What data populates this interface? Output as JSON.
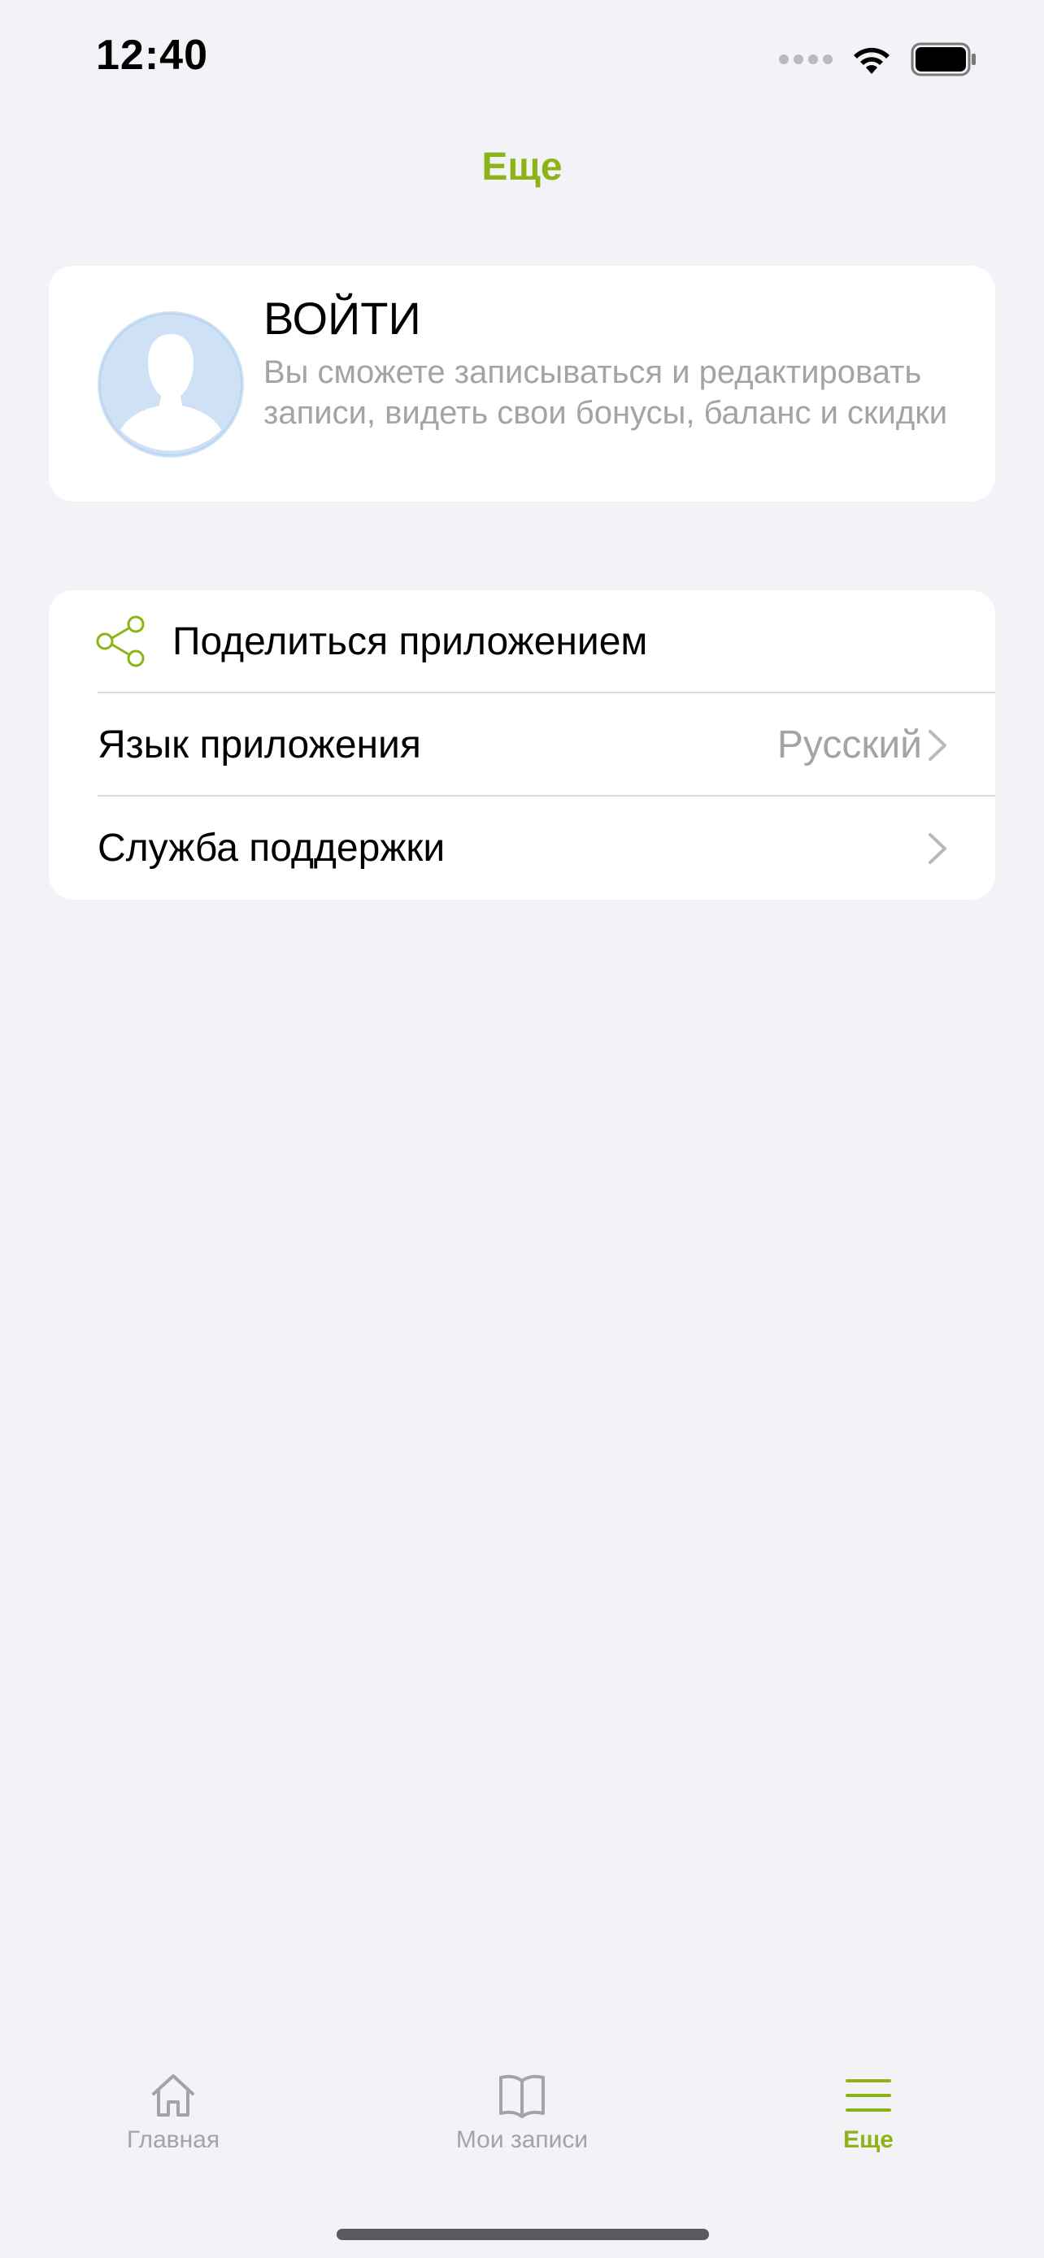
{
  "status_bar": {
    "time": "12:40"
  },
  "header": {
    "title": "Еще"
  },
  "login": {
    "title": "ВОЙТИ",
    "description": "Вы сможете записываться и редактировать записи, видеть свои бонусы, баланс и скидки"
  },
  "settings": {
    "share_label": "Поделиться приложением",
    "language_label": "Язык приложения",
    "language_value": "Русский",
    "support_label": "Служба поддержки"
  },
  "tabs": [
    {
      "label": "Главная",
      "icon": "home-icon"
    },
    {
      "label": "Мои записи",
      "icon": "book-icon"
    },
    {
      "label": "Еще",
      "icon": "menu-icon"
    }
  ],
  "colors": {
    "accent": "#8cb416",
    "background": "#f2f2f7",
    "secondary_text": "#a3a3a8",
    "avatar_bg": "#cfe1f4"
  }
}
